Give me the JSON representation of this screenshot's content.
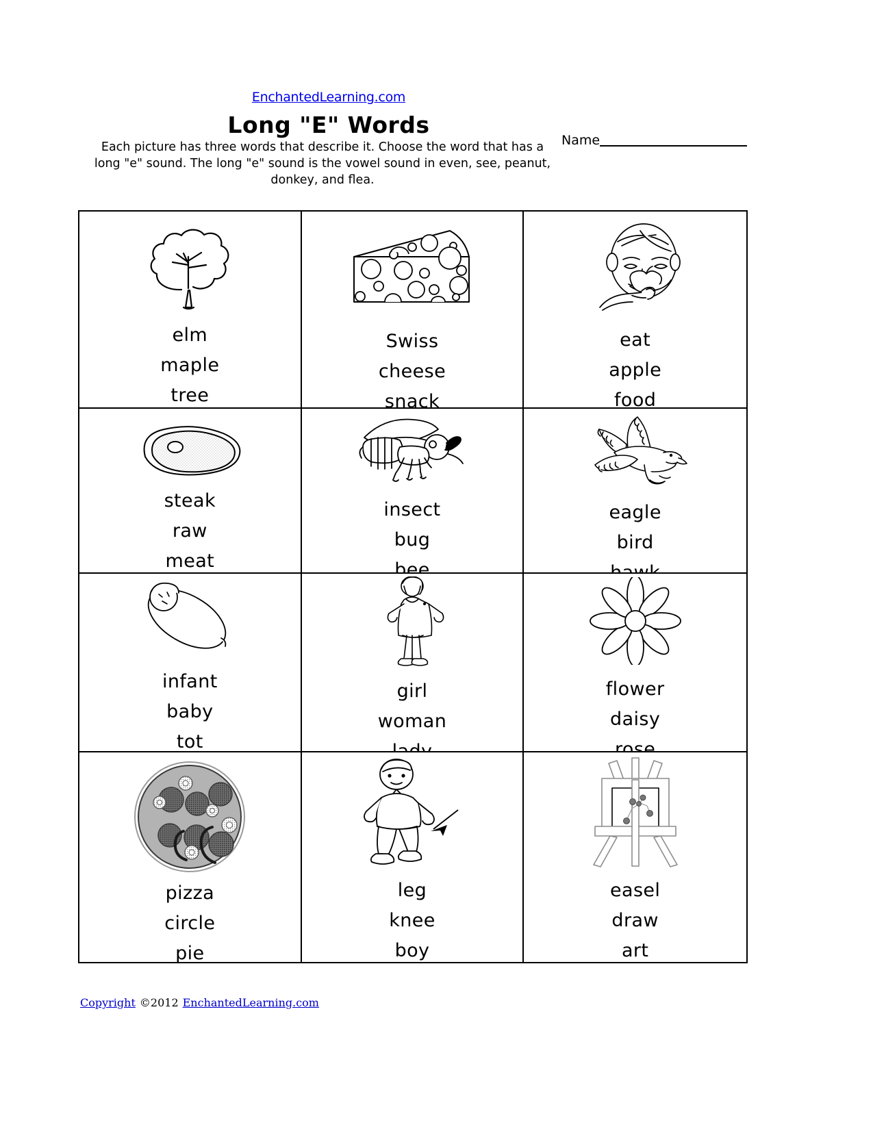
{
  "header": {
    "site_link": "EnchantedLearning.com",
    "title": "Long \"E\" Words",
    "instructions": "Each picture has three words that describe it. Choose the word that has a long \"e\" sound. The long \"e\" sound is the vowel sound in even, see, peanut, donkey, and flea.",
    "name_label": "Name"
  },
  "cells": [
    {
      "icon": "tree-icon",
      "words": [
        "elm",
        "maple",
        "tree"
      ]
    },
    {
      "icon": "cheese-icon",
      "words": [
        "Swiss",
        "cheese",
        "snack"
      ]
    },
    {
      "icon": "eating-face-icon",
      "words": [
        "eat",
        "apple",
        "food"
      ]
    },
    {
      "icon": "steak-icon",
      "words": [
        "steak",
        "raw",
        "meat"
      ]
    },
    {
      "icon": "bee-icon",
      "words": [
        "insect",
        "bug",
        "bee"
      ]
    },
    {
      "icon": "eagle-icon",
      "words": [
        "eagle",
        "bird",
        "hawk"
      ]
    },
    {
      "icon": "swaddled-baby-icon",
      "words": [
        "infant",
        "baby",
        "tot"
      ]
    },
    {
      "icon": "girl-icon",
      "words": [
        "girl",
        "woman",
        "lady"
      ]
    },
    {
      "icon": "daisy-icon",
      "words": [
        "flower",
        "daisy",
        "rose"
      ]
    },
    {
      "icon": "pizza-icon",
      "words": [
        "pizza",
        "circle",
        "pie"
      ]
    },
    {
      "icon": "boy-leg-arrow-icon",
      "words": [
        "leg",
        "knee",
        "boy"
      ]
    },
    {
      "icon": "easel-icon",
      "words": [
        "easel",
        "draw",
        "art"
      ]
    }
  ],
  "footer": {
    "copyright_word": "Copyright",
    "copyright_symbol_year": "©2012",
    "copyright_site": "EnchantedLearning.com"
  },
  "colors": {
    "link": "#0000ee",
    "ink": "#000000",
    "pizza_fill": "#b3b3b3",
    "steak_fill": "#ededed"
  }
}
